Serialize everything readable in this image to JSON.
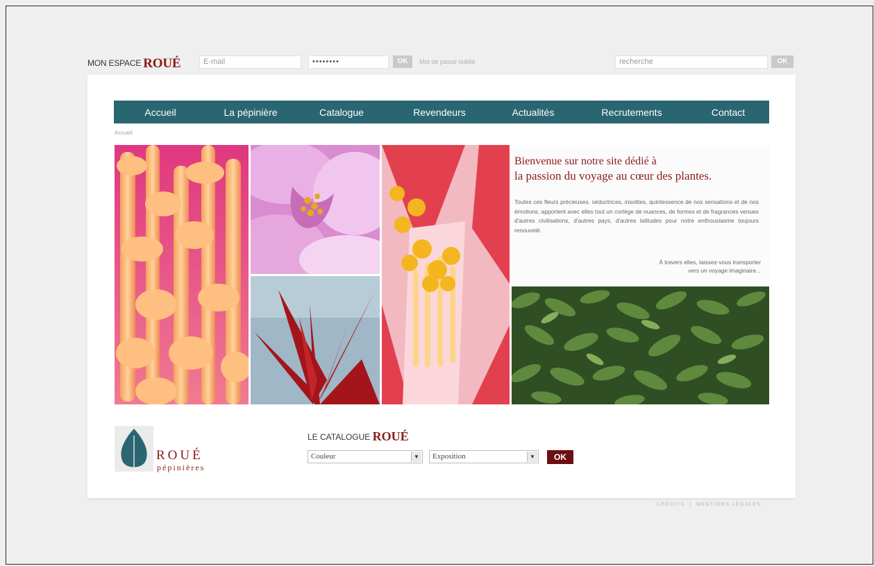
{
  "topbar": {
    "mon_espace_label": "MON ESPACE",
    "brand": "ROUÉ",
    "email_placeholder": "E-mail",
    "password_value": "••••••••",
    "login_ok": "OK",
    "forgot_password": "Mot de passe oublié",
    "search_placeholder": "recherche",
    "search_ok": "OK"
  },
  "nav": {
    "items": [
      "Accueil",
      "La pépinière",
      "Catalogue",
      "Revendeurs",
      "Actualités",
      "Recrutements",
      "Contact"
    ]
  },
  "breadcrumb": "Accueil",
  "intro": {
    "title_line1": "Bienvenue sur notre site dédié à",
    "title_line2": "la passion du voyage au cœur des plantes.",
    "body": "Toutes ces fleurs précieuses, séductrices, insolites, quintessence de nos sensations et de nos émotions, apportent avec elles tout un cortège de nuances, de formes et de fragrances venues d'autres civilisations, d'autres pays, d'autres latitudes pour notre enthousiasme toujours renouvelé.",
    "cta_line1": "À travers elles, laissez-vous transporter",
    "cta_line2": "vers un voyage imaginaire..."
  },
  "logo": {
    "word": "ROUÉ",
    "sub": "pépinières"
  },
  "catalogue": {
    "label": "LE CATALOGUE",
    "brand": "ROUÉ",
    "couleur_selected": "Couleur",
    "exposition_selected": "Exposition",
    "ok": "OK"
  },
  "footer": {
    "credits": "CRÉDITS",
    "mentions": "MENTIONS LÉGALES"
  },
  "colors": {
    "nav_bg": "#2a6672",
    "brand_red": "#8b1a1a",
    "ok_dark": "#6e0f12",
    "page_bg": "#efefef"
  }
}
